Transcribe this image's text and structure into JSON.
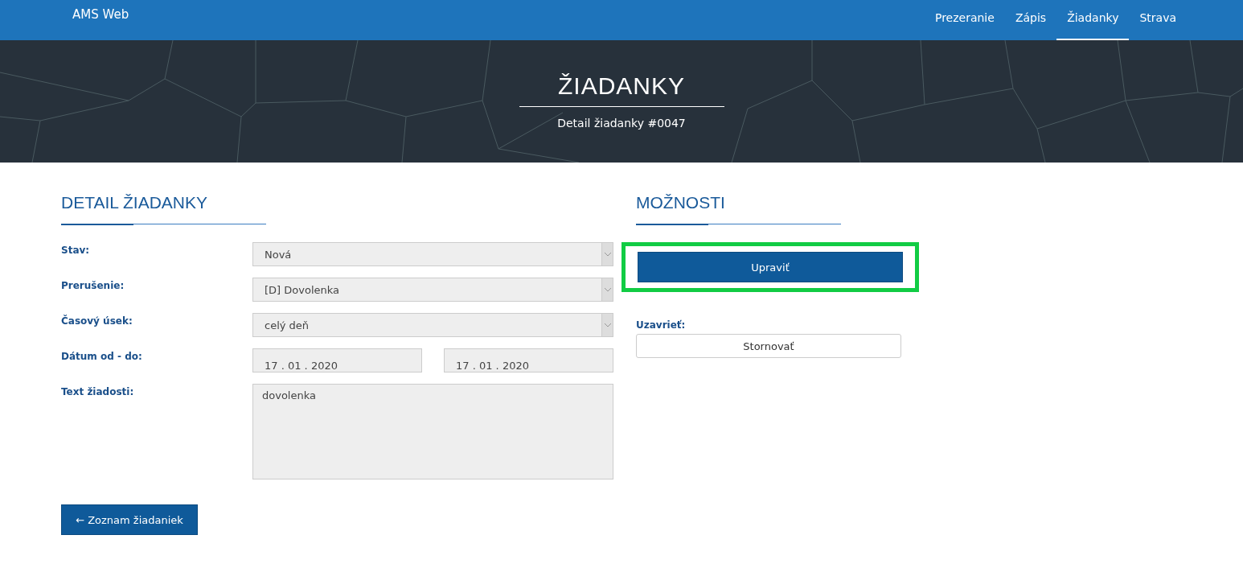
{
  "navbar": {
    "brand": "AMS Web",
    "items": [
      {
        "label": "Prezeranie",
        "selected": false
      },
      {
        "label": "Zápis",
        "selected": false
      },
      {
        "label": "Žiadanky",
        "selected": true
      },
      {
        "label": "Strava",
        "selected": false
      }
    ]
  },
  "hero": {
    "title": "ŽIADANKY",
    "subtitle": "Detail žiadanky #0047"
  },
  "detail": {
    "heading": "DETAIL ŽIADANKY",
    "fields": [
      {
        "kind": "select",
        "label": "Stav:",
        "value": "Nová"
      },
      {
        "kind": "select",
        "label": "Prerušenie:",
        "value": "[D] Dovolenka"
      },
      {
        "kind": "select",
        "label": "Časový úsek:",
        "value": "celý deň"
      },
      {
        "kind": "daterange",
        "label": "Dátum od - do:",
        "values": [
          "17 . 01 . 2020",
          "17 . 01 . 2020"
        ]
      },
      {
        "kind": "textarea",
        "label": "Text žiadosti:",
        "value": "dovolenka"
      }
    ],
    "back_button": "← Zoznam žiadaniek"
  },
  "options": {
    "heading": "MOŽNOSTI",
    "edit_button": {
      "label": "Upraviť",
      "highlighted": true
    },
    "close_label": "Uzavrieť:",
    "cancel_button": "Stornovať"
  }
}
